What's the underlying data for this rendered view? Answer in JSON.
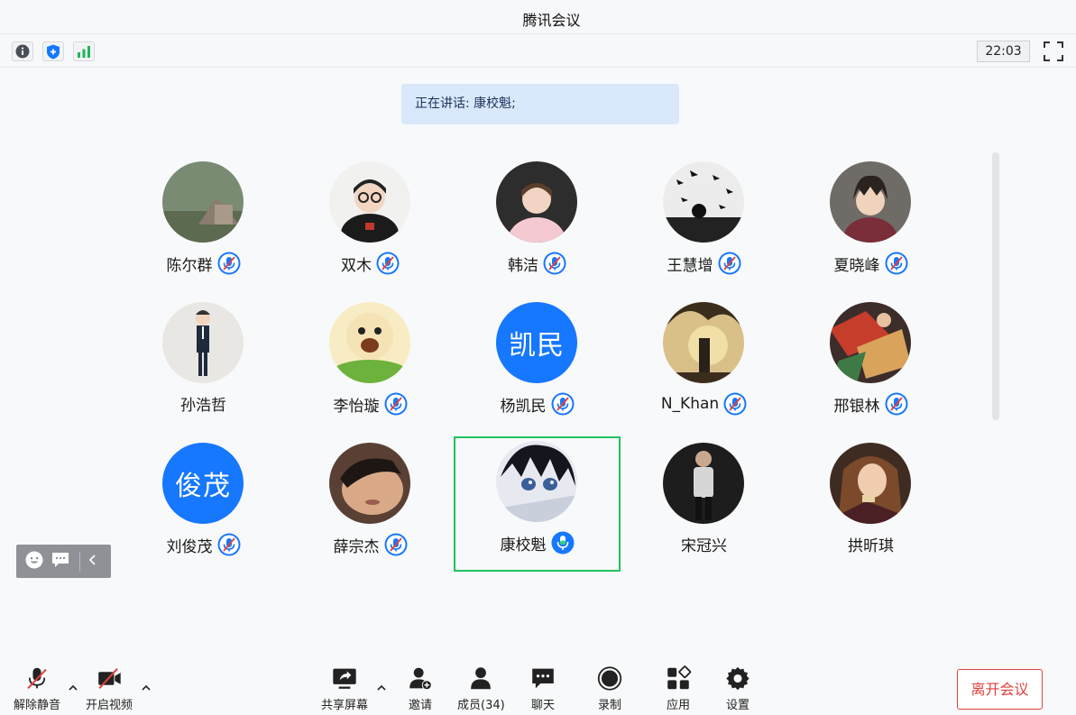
{
  "window": {
    "title": "腾讯会议"
  },
  "toolbar": {
    "icons": [
      "info-icon",
      "shield-icon",
      "signal-icon"
    ],
    "clock": "22:03",
    "fullscreen_icon": "fullscreen-icon"
  },
  "speaking": {
    "text": "正在讲话: 康校魁;"
  },
  "participants": [
    {
      "name": "陈尔群",
      "muted": true,
      "avatar": "photo"
    },
    {
      "name": "双木",
      "muted": true,
      "avatar": "photo"
    },
    {
      "name": "韩洁",
      "muted": true,
      "avatar": "photo"
    },
    {
      "name": "王慧增",
      "muted": true,
      "avatar": "photo"
    },
    {
      "name": "夏晓峰",
      "muted": true,
      "avatar": "photo"
    },
    {
      "name": "孙浩哲",
      "muted": false,
      "avatar": "photo"
    },
    {
      "name": "李怡璇",
      "muted": true,
      "avatar": "photo"
    },
    {
      "name": "杨凯民",
      "muted": true,
      "avatar": "text",
      "avatar_text": "凯民"
    },
    {
      "name": "N_Khan",
      "muted": true,
      "avatar": "photo"
    },
    {
      "name": "邢银林",
      "muted": true,
      "avatar": "photo"
    },
    {
      "name": "刘俊茂",
      "muted": true,
      "avatar": "text",
      "avatar_text": "俊茂"
    },
    {
      "name": "薛宗杰",
      "muted": true,
      "avatar": "photo"
    },
    {
      "name": "康校魁",
      "muted": false,
      "speaking": true,
      "avatar": "photo"
    },
    {
      "name": "宋冠兴",
      "muted": false,
      "avatar": "photo"
    },
    {
      "name": "拱昕琪",
      "muted": false,
      "avatar": "photo"
    }
  ],
  "reactions": {
    "icons": [
      "emoji-icon",
      "chat-bubble-icon",
      "collapse-left-icon"
    ]
  },
  "bottombar": {
    "unmute": "解除静音",
    "start_video": "开启视频",
    "share_screen": "共享屏幕",
    "invite": "邀请",
    "members": "成员(34)",
    "chat": "聊天",
    "record": "录制",
    "apps": "应用",
    "settings": "设置",
    "leave": "离开会议"
  },
  "colors": {
    "accent": "#1677ff",
    "speaking_border": "#21c25e",
    "leave": "#e2413a",
    "speaking_banner": "#d9e8fb"
  }
}
